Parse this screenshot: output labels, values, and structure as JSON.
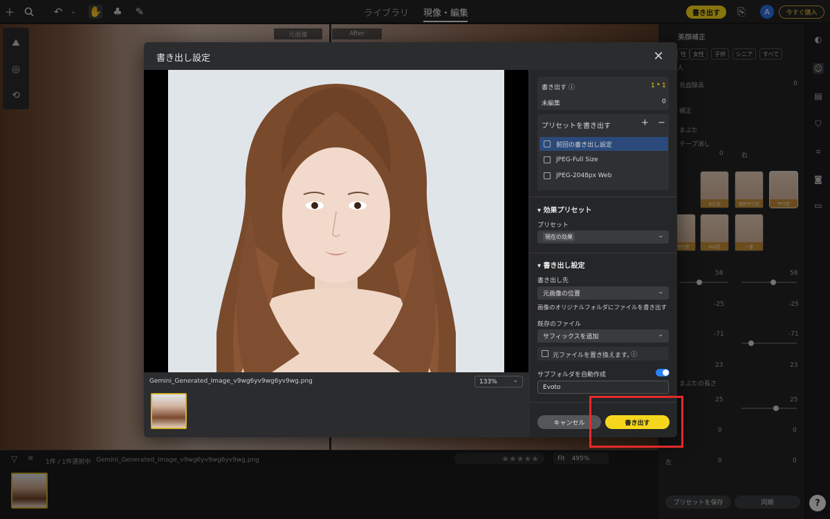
{
  "topbar": {
    "tab_library": "ライブラリ",
    "tab_develop": "現像・編集",
    "export_button": "書き出す",
    "avatar_letter": "A",
    "buy_button": "今すぐ購入"
  },
  "canvas": {
    "before_label": "元画像",
    "after_label": "After"
  },
  "bottombar": {
    "selection_count": "1件 / 1件選択中",
    "filename": "Gemini_Generated_Image_v9wg6yv9wg6yv9wg.png",
    "fit_label": "Fit",
    "zoom_value": "495%"
  },
  "right_panel": {
    "section_title": "美顔補正",
    "chips": [
      "性",
      "女性",
      "子供",
      "シニア",
      "すべて"
    ],
    "chip_extra": "人",
    "red_eye": "充血除去",
    "red_eye_value": "0",
    "correction": "補正",
    "eyelid": "まぶた",
    "tape": "テープ消し",
    "tape_value": "0",
    "right_label": "右",
    "none_label": "なし",
    "eye_captions": [
      "末広型",
      "幅狭平行型",
      "平行型",
      "幅平行型",
      "MIX型",
      "一重"
    ],
    "values": [
      "58",
      "58",
      "-25",
      "-25",
      "-71",
      "-71",
      "23",
      "23",
      "25",
      "25",
      "0",
      "0",
      "0",
      "0"
    ],
    "eyelid_length": "まぶたの長さ",
    "left_label": "左",
    "save_preset": "プリセットを保存",
    "sync": "同期"
  },
  "dialog": {
    "title": "書き出し設定",
    "filename": "Gemini_Generated_Image_v9wg6yv9wg6yv9wg.png",
    "zoom": "133%",
    "export_label": "書き出す",
    "export_count": "1 * 1",
    "unedited_label": "未編集",
    "unedited_count": "0",
    "preset_header": "プリセットを書き出す",
    "presets": [
      "前回の書き出し設定",
      "JPEG-Full Size",
      "JPEG-2048px Web"
    ],
    "effect_preset_header": "効果プリセット",
    "preset_label": "プリセット",
    "preset_value": "現在の効果",
    "export_settings_header": "書き出し設定",
    "destination_label": "書き出し先",
    "destination_value": "元画像の位置",
    "destination_note": "画像のオリジナルフォルダにファイルを書き出す",
    "existing_label": "既存のファイル",
    "existing_value": "サフィックスを追加",
    "replace_label": "元ファイルを置き換えます。",
    "subfolder_label": "サブフォルダを自動作成",
    "subfolder_value": "Evoto",
    "cancel_button": "キャンセル",
    "export_button": "書き出す"
  },
  "colors": {
    "accent_yellow": "#f5d61d",
    "toggle_blue": "#2b82f2",
    "selection_blue": "#2b4a7b",
    "highlight_red": "#e52b2b"
  }
}
